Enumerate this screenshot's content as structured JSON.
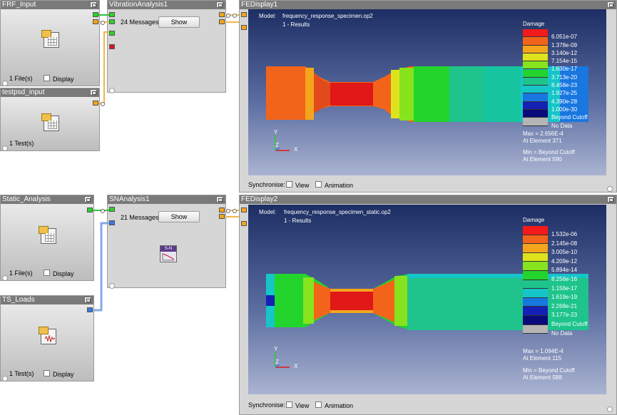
{
  "glyphs": {
    "frf_input": {
      "title": "FRF_Input",
      "status": "1 File(s)",
      "display_label": "Display"
    },
    "vibration": {
      "title": "VibrationAnalysis1",
      "messages": "24 Messages",
      "show_label": "Show"
    },
    "testpsd": {
      "title": "testpsd_input",
      "status": "1 Test(s)"
    },
    "static_analysis": {
      "title": "Static_Analysis",
      "status": "1 File(s)",
      "display_label": "Display"
    },
    "sn_analysis": {
      "title": "SNAnalysis1",
      "messages": "21 Messages",
      "show_label": "Show",
      "icon_label": "S-N"
    },
    "ts_loads": {
      "title": "TS_Loads",
      "status": "1 Test(s)",
      "display_label": "Display"
    }
  },
  "displays": [
    {
      "title": "FEDisplay1",
      "model_label": "Model:",
      "model_file": "frequency_response_specimen.op2",
      "results": "1 - Results",
      "legend_title": "Damage",
      "legend": [
        {
          "label": "6.051e-07",
          "color": "#f51a1a"
        },
        {
          "label": "1.378e-09",
          "color": "#f2641a"
        },
        {
          "label": "3.140e-12",
          "color": "#f4a51c"
        },
        {
          "label": "7.154e-15",
          "color": "#dfe31d"
        },
        {
          "label": "1.630e-17",
          "color": "#86e31e"
        },
        {
          "label": "3.713e-20",
          "color": "#23d42c"
        },
        {
          "label": "8.458e-23",
          "color": "#1ec48c"
        },
        {
          "label": "1.927e-25",
          "color": "#16c5c7"
        },
        {
          "label": "4.390e-28",
          "color": "#1877e0"
        },
        {
          "label": "1.000e-30",
          "color": "#1520b5"
        }
      ],
      "beyond_label": "Beyond Cutoff",
      "beyond_color": "#0a0a7a",
      "nodata_label": "No Data",
      "nodata_color": "#b5b5b5",
      "max_text": "Max = 2.656E-4",
      "max_elem": "At Element 371",
      "min_text": "Min = Beyond Cutoff",
      "min_elem": "At Element 590",
      "sync_label": "Synchronise:",
      "view_label": "View",
      "anim_label": "Animation",
      "axis_y": "Y",
      "axis_z": "Z",
      "axis_x": "X"
    },
    {
      "title": "FEDisplay2",
      "model_label": "Model:",
      "model_file": "frequency_response_specimen_static.op2",
      "results": "1 - Results",
      "legend_title": "Damage",
      "legend": [
        {
          "label": "1.532e-06",
          "color": "#f51a1a"
        },
        {
          "label": "2.145e-08",
          "color": "#f2641a"
        },
        {
          "label": "3.005e-10",
          "color": "#f4a51c"
        },
        {
          "label": "4.209e-12",
          "color": "#dfe31d"
        },
        {
          "label": "5.894e-14",
          "color": "#86e31e"
        },
        {
          "label": "8.256e-16",
          "color": "#23d42c"
        },
        {
          "label": "1.156e-17",
          "color": "#1ec48c"
        },
        {
          "label": "1.619e-19",
          "color": "#16c5c7"
        },
        {
          "label": "2.268e-21",
          "color": "#1877e0"
        },
        {
          "label": "3.177e-23",
          "color": "#1520b5"
        }
      ],
      "beyond_label": "Beyond Cutoff",
      "beyond_color": "#0a0a7a",
      "nodata_label": "No Data",
      "nodata_color": "#b5b5b5",
      "max_text": "Max = 1.094E-4",
      "max_elem": "At Element 115",
      "min_text": "Min = Beyond Cutoff",
      "min_elem": "At Element 588",
      "sync_label": "Synchronise:",
      "view_label": "View",
      "anim_label": "Animation",
      "axis_y": "Y",
      "axis_z": "Z",
      "axis_x": "X"
    }
  ]
}
